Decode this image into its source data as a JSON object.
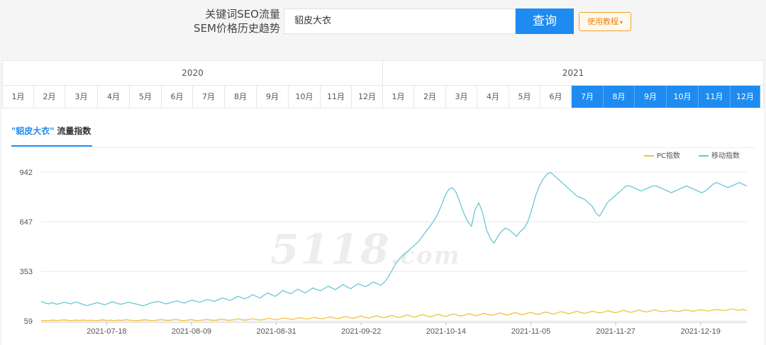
{
  "header": {
    "brand_line1": "关键词SEO流量",
    "brand_line2": "SEM价格历史趋势",
    "search_value": "貂皮大衣",
    "search_button": "查询",
    "tutorial_button": "使用教程",
    "tutorial_caret": "▾"
  },
  "timeline": {
    "years": [
      "2020",
      "2021"
    ],
    "months_2020": [
      "1月",
      "2月",
      "3月",
      "4月",
      "5月",
      "6月",
      "7月",
      "8月",
      "9月",
      "10月",
      "11月",
      "12月"
    ],
    "months_2021": [
      "1月",
      "2月",
      "3月",
      "4月",
      "5月",
      "6月",
      "7月",
      "8月",
      "9月",
      "10月",
      "11月",
      "12月"
    ],
    "selected_2021_months": [
      "7月",
      "8月",
      "9月",
      "10月",
      "11月",
      "12月"
    ]
  },
  "tab": {
    "keyword": "\"貂皮大衣\"",
    "suffix": "流量指数"
  },
  "watermark": {
    "main": "5118",
    "sub": ".com"
  },
  "colors": {
    "accent": "#1e8bf0",
    "pc_series": "#f2c13c",
    "mobile_series": "#6cc6d6"
  },
  "chart_data": {
    "type": "line",
    "title": "",
    "xlabel": "",
    "ylabel": "",
    "ylim": [
      59,
      942
    ],
    "yticks": [
      "942",
      "647",
      "353",
      "59"
    ],
    "ytick_values": [
      942,
      647,
      353,
      59
    ],
    "x_tick_labels": [
      "2021-07-18",
      "2021-08-09",
      "2021-08-31",
      "2021-09-22",
      "2021-10-14",
      "2021-11-05",
      "2021-11-27",
      "2021-12-19"
    ],
    "x_start": "2021-07-01",
    "x_end": "2021-12-31",
    "grid": true,
    "legend_position": "top-right",
    "series": [
      {
        "name": "PC指数",
        "color": "#f2c13c",
        "values": [
          59,
          62,
          60,
          64,
          61,
          63,
          66,
          62,
          60,
          64,
          62,
          65,
          61,
          63,
          60,
          62,
          66,
          61,
          63,
          60,
          64,
          62,
          67,
          63,
          61,
          60,
          64,
          66,
          62,
          61,
          63,
          68,
          64,
          62,
          65,
          69,
          63,
          60,
          64,
          67,
          62,
          61,
          65,
          68,
          64,
          62,
          66,
          70,
          64,
          63,
          67,
          71,
          66,
          64,
          68,
          72,
          66,
          65,
          69,
          74,
          70,
          67,
          71,
          76,
          72,
          68,
          73,
          78,
          74,
          70,
          76,
          80,
          74,
          71,
          78,
          84,
          76,
          72,
          80,
          86,
          78,
          74,
          82,
          88,
          80,
          76,
          84,
          90,
          82,
          78,
          86,
          92,
          84,
          80,
          88,
          94,
          86,
          82,
          90,
          96,
          88,
          84,
          92,
          98,
          90,
          86,
          94,
          100,
          92,
          88,
          96,
          102,
          94,
          90,
          98,
          104,
          96,
          92,
          100,
          106,
          98,
          94,
          102,
          108,
          100,
          96,
          104,
          110,
          102,
          98,
          106,
          112,
          104,
          100,
          108,
          114,
          106,
          102,
          110,
          116,
          108,
          104,
          110,
          118,
          110,
          106,
          112,
          120,
          112,
          108,
          114,
          122,
          114,
          110,
          116,
          124,
          116,
          112,
          118,
          126,
          118,
          114,
          116,
          122,
          118,
          114,
          118,
          124,
          120,
          116,
          120,
          126,
          122,
          118,
          122,
          128,
          124,
          120,
          124,
          130,
          126,
          122,
          128,
          120
        ]
      },
      {
        "name": "移动指数",
        "color": "#6cc6d6",
        "values": [
          175,
          165,
          160,
          168,
          158,
          162,
          170,
          165,
          160,
          172,
          166,
          158,
          150,
          155,
          162,
          168,
          160,
          155,
          165,
          172,
          164,
          158,
          162,
          170,
          166,
          160,
          155,
          148,
          156,
          165,
          170,
          175,
          168,
          160,
          165,
          172,
          178,
          170,
          165,
          175,
          182,
          176,
          170,
          178,
          186,
          180,
          175,
          185,
          195,
          188,
          180,
          190,
          205,
          198,
          190,
          200,
          215,
          205,
          195,
          210,
          225,
          215,
          205,
          220,
          240,
          230,
          220,
          232,
          248,
          236,
          225,
          240,
          255,
          245,
          238,
          250,
          265,
          255,
          245,
          260,
          275,
          262,
          250,
          265,
          280,
          270,
          262,
          275,
          290,
          280,
          270,
          290,
          320,
          360,
          400,
          430,
          450,
          470,
          490,
          510,
          530,
          560,
          590,
          620,
          650,
          690,
          740,
          800,
          840,
          850,
          820,
          760,
          700,
          650,
          620,
          720,
          760,
          700,
          600,
          550,
          520,
          560,
          590,
          610,
          600,
          580,
          560,
          590,
          610,
          650,
          720,
          800,
          860,
          900,
          930,
          940,
          920,
          900,
          880,
          860,
          840,
          820,
          800,
          790,
          780,
          760,
          740,
          700,
          680,
          720,
          760,
          780,
          800,
          820,
          840,
          860,
          860,
          850,
          840,
          830,
          840,
          850,
          860,
          860,
          850,
          840,
          830,
          820,
          830,
          840,
          850,
          860,
          850,
          840,
          830,
          820,
          830,
          850,
          870,
          880,
          870,
          860,
          850,
          860,
          870,
          880,
          870,
          860
        ]
      }
    ]
  }
}
